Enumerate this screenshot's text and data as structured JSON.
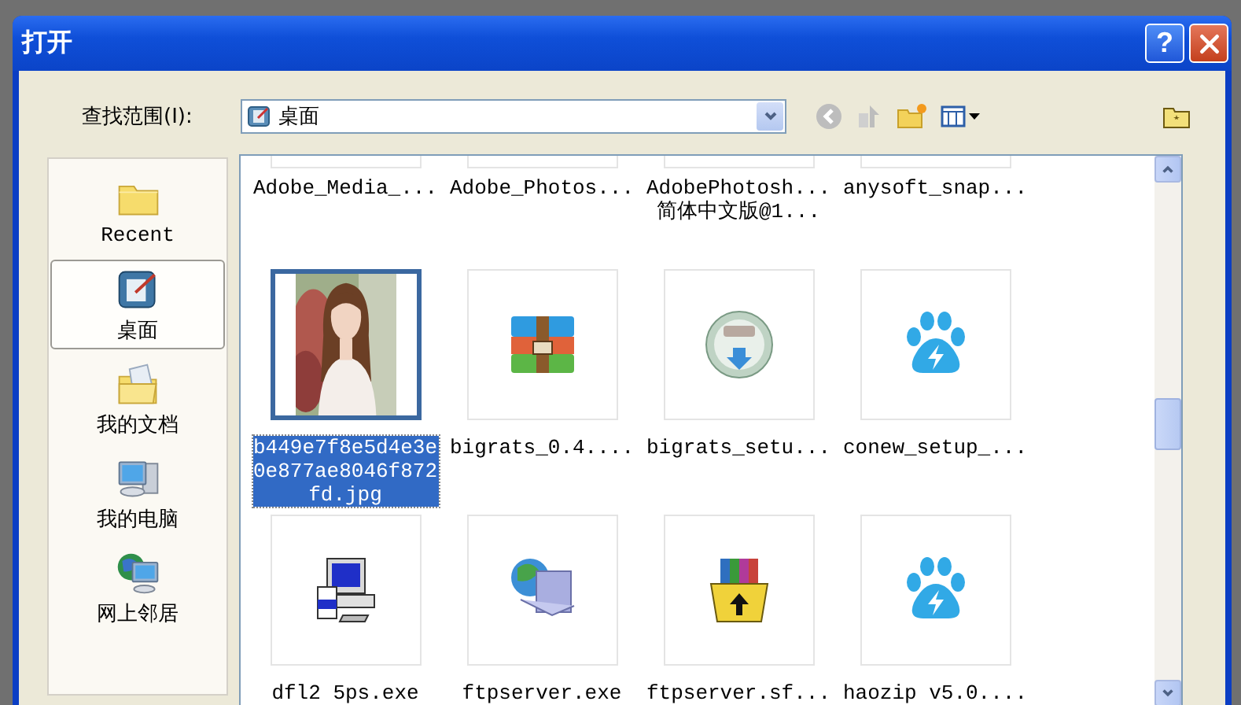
{
  "window": {
    "title": "打开",
    "help_button": "?"
  },
  "look_in": {
    "label": "查找范围(I):",
    "value": "桌面"
  },
  "places": [
    {
      "label": "Recent",
      "kind": "recent",
      "selected": false
    },
    {
      "label": "桌面",
      "kind": "desktop",
      "selected": true
    },
    {
      "label": "我的文档",
      "kind": "documents",
      "selected": false
    },
    {
      "label": "我的电脑",
      "kind": "computer",
      "selected": false
    },
    {
      "label": "网上邻居",
      "kind": "network",
      "selected": false
    }
  ],
  "files": [
    {
      "name": "Adobe_Media_...",
      "kind": "scrolled",
      "selected": false
    },
    {
      "name": "Adobe_Photos...",
      "kind": "scrolled",
      "selected": false
    },
    {
      "name": "AdobePhotosh... 简体中文版@1...",
      "kind": "scrolled",
      "selected": false
    },
    {
      "name": "anysoft_snap...",
      "kind": "scrolled",
      "selected": false
    },
    {
      "name": "b449e7f8e5d4e3e0e877ae8046f872fd.jpg",
      "kind": "picture",
      "selected": true
    },
    {
      "name": "bigrats_0.4....",
      "kind": "archive",
      "selected": false
    },
    {
      "name": "bigrats_setu...",
      "kind": "disc",
      "selected": false
    },
    {
      "name": "conew_setup_...",
      "kind": "paw",
      "selected": false
    },
    {
      "name": "dfl2 5ps.exe",
      "kind": "installer",
      "selected": false
    },
    {
      "name": "ftpserver.exe",
      "kind": "network",
      "selected": false
    },
    {
      "name": "ftpserver.sf...",
      "kind": "package",
      "selected": false
    },
    {
      "name": "haozip v5.0....",
      "kind": "paw",
      "selected": false
    }
  ]
}
